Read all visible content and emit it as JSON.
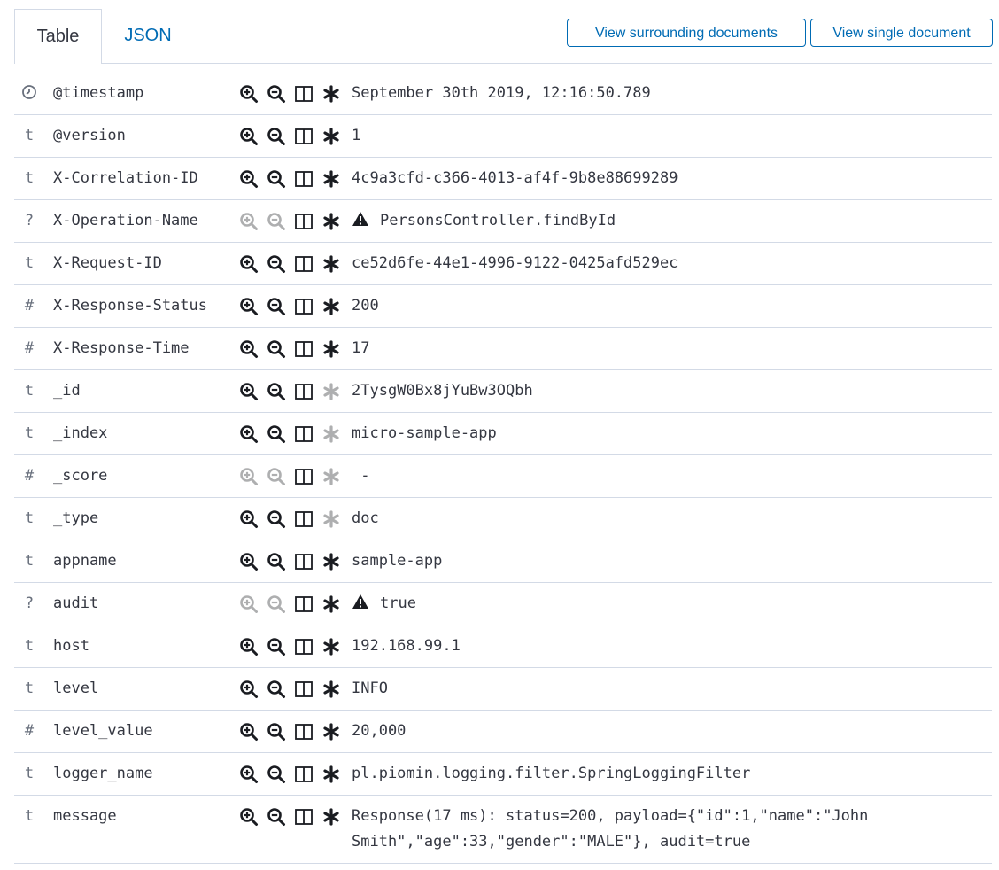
{
  "tabs": {
    "table": "Table",
    "json": "JSON"
  },
  "buttons": {
    "surrounding": "View surrounding documents",
    "single": "View single document"
  },
  "colors": {
    "link": "#006bb4",
    "border": "#d3dae6",
    "text": "#343741"
  },
  "rows": [
    {
      "type_icon": "clock-icon",
      "type": "",
      "name": "@timestamp",
      "value": "September 30th 2019, 12:16:50.789",
      "warn": false,
      "filter_enabled": true,
      "exists_enabled": true
    },
    {
      "type": "t",
      "name": "@version",
      "value": "1",
      "warn": false,
      "filter_enabled": true,
      "exists_enabled": true
    },
    {
      "type": "t",
      "name": "X-Correlation-ID",
      "value": "4c9a3cfd-c366-4013-af4f-9b8e88699289",
      "warn": false,
      "filter_enabled": true,
      "exists_enabled": true
    },
    {
      "type": "?",
      "name": "X-Operation-Name",
      "value": "PersonsController.findById",
      "warn": true,
      "filter_enabled": false,
      "exists_enabled": true
    },
    {
      "type": "t",
      "name": "X-Request-ID",
      "value": "ce52d6fe-44e1-4996-9122-0425afd529ec",
      "warn": false,
      "filter_enabled": true,
      "exists_enabled": true
    },
    {
      "type": "#",
      "name": "X-Response-Status",
      "value": "200",
      "warn": false,
      "filter_enabled": true,
      "exists_enabled": true
    },
    {
      "type": "#",
      "name": "X-Response-Time",
      "value": "17",
      "warn": false,
      "filter_enabled": true,
      "exists_enabled": true
    },
    {
      "type": "t",
      "name": "_id",
      "value": "2TysgW0Bx8jYuBw3OQbh",
      "warn": false,
      "filter_enabled": true,
      "exists_enabled": false
    },
    {
      "type": "t",
      "name": "_index",
      "value": "micro-sample-app",
      "warn": false,
      "filter_enabled": true,
      "exists_enabled": false
    },
    {
      "type": "#",
      "name": "_score",
      "value": " -",
      "warn": false,
      "filter_enabled": false,
      "exists_enabled": false
    },
    {
      "type": "t",
      "name": "_type",
      "value": "doc",
      "warn": false,
      "filter_enabled": true,
      "exists_enabled": false
    },
    {
      "type": "t",
      "name": "appname",
      "value": "sample-app",
      "warn": false,
      "filter_enabled": true,
      "exists_enabled": true
    },
    {
      "type": "?",
      "name": "audit",
      "value": "true",
      "warn": true,
      "filter_enabled": false,
      "exists_enabled": true
    },
    {
      "type": "t",
      "name": "host",
      "value": "192.168.99.1",
      "warn": false,
      "filter_enabled": true,
      "exists_enabled": true
    },
    {
      "type": "t",
      "name": "level",
      "value": "INFO",
      "warn": false,
      "filter_enabled": true,
      "exists_enabled": true
    },
    {
      "type": "#",
      "name": "level_value",
      "value": "20,000",
      "warn": false,
      "filter_enabled": true,
      "exists_enabled": true
    },
    {
      "type": "t",
      "name": "logger_name",
      "value": "pl.piomin.logging.filter.SpringLoggingFilter",
      "warn": false,
      "filter_enabled": true,
      "exists_enabled": true
    },
    {
      "type": "t",
      "name": "message",
      "value": "Response(17 ms): status=200, payload={\"id\":1,\"name\":\"John Smith\",\"age\":33,\"gender\":\"MALE\"}, audit=true",
      "warn": false,
      "filter_enabled": true,
      "exists_enabled": true,
      "tall": true
    }
  ]
}
